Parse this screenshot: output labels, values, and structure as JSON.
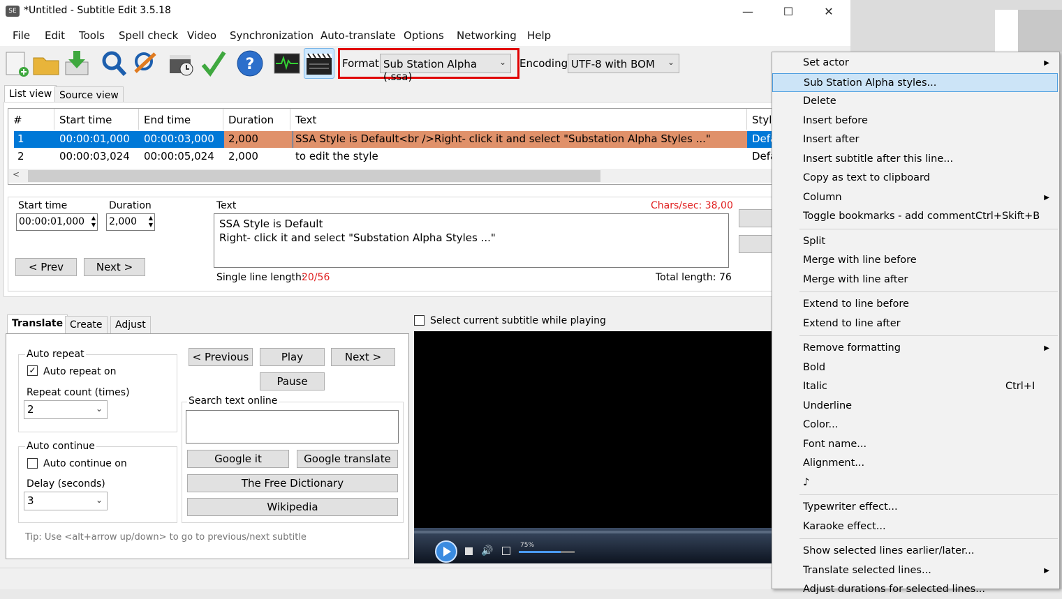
{
  "window": {
    "title": "*Untitled - Subtitle Edit 3.5.18",
    "app_icon_text": "SE",
    "minimize": "—",
    "maximize": "☐",
    "close": "✕"
  },
  "menubar": [
    "File",
    "Edit",
    "Tools",
    "Spell check",
    "Video",
    "Synchronization",
    "Auto-translate",
    "Options",
    "Networking",
    "Help"
  ],
  "toolbar": {
    "icons": [
      "new-file-icon",
      "open-folder-icon",
      "save-download-icon",
      "find-icon",
      "replace-icon",
      "visual-sync-icon",
      "spell-check-icon",
      "help-icon",
      "waveform-icon",
      "video-icon"
    ],
    "format_label": "Format",
    "format_value": "Sub Station Alpha (.ssa)",
    "encoding_label": "Encoding",
    "encoding_value": "UTF-8 with BOM"
  },
  "view_tabs": [
    "List view",
    "Source view"
  ],
  "grid": {
    "columns": [
      "#",
      "Start time",
      "End time",
      "Duration",
      "Text",
      "Style"
    ],
    "rows": [
      {
        "num": "1",
        "start": "00:00:01,000",
        "end": "00:00:03,000",
        "duration": "2,000",
        "text": "SSA Style is Default<br />Right- click it and select \"Substation Alpha Styles ...\"",
        "style": "Default"
      },
      {
        "num": "2",
        "start": "00:00:03,024",
        "end": "00:00:05,024",
        "duration": "2,000",
        "text": "to edit the style",
        "style": "Default"
      }
    ]
  },
  "editor": {
    "start_time_label": "Start time",
    "start_time_value": "00:00:01,000",
    "duration_label": "Duration",
    "duration_value": "2,000",
    "text_label": "Text",
    "chars_sec": "Chars/sec: 38,00",
    "text_line1": "SSA Style is Default",
    "text_line2": "Right- click it and select \"Substation Alpha Styles ...\"",
    "prev_button": "< Prev",
    "next_button": "Next >",
    "single_line_label": "Single line length:",
    "single_line_value": "20/56",
    "total_length": "Total length: 76"
  },
  "lower_tabs": [
    "Translate",
    "Create",
    "Adjust"
  ],
  "translate": {
    "auto_repeat_group": "Auto repeat",
    "auto_repeat_on": "Auto repeat on",
    "repeat_count_label": "Repeat count (times)",
    "repeat_count_value": "2",
    "auto_continue_group": "Auto continue",
    "auto_continue_on": "Auto continue on",
    "delay_label": "Delay (seconds)",
    "delay_value": "3",
    "previous_button": "< Previous",
    "play_button": "Play",
    "next_button": "Next >",
    "pause_button": "Pause",
    "search_group": "Search text online",
    "google_it": "Google it",
    "google_translate": "Google translate",
    "free_dictionary": "The Free Dictionary",
    "wikipedia": "Wikipedia",
    "tip": "Tip: Use <alt+arrow up/down> to go to previous/next subtitle"
  },
  "video": {
    "select_current": "Select current subtitle while playing",
    "volume": "75%"
  },
  "context_menu": [
    {
      "label": "Set actor",
      "submenu": true
    },
    {
      "label": "Sub Station Alpha styles...",
      "highlight": true
    },
    {
      "label": "Delete"
    },
    {
      "label": "Insert before"
    },
    {
      "label": "Insert after"
    },
    {
      "label": "Insert subtitle after this line..."
    },
    {
      "label": "Copy as text to clipboard"
    },
    {
      "label": "Column",
      "submenu": true
    },
    {
      "label": "Toggle bookmarks - add comment",
      "shortcut": "Ctrl+Skift+B"
    },
    {
      "separator": true
    },
    {
      "label": "Split"
    },
    {
      "label": "Merge with line before"
    },
    {
      "label": "Merge with line after"
    },
    {
      "separator": true
    },
    {
      "label": "Extend to line before"
    },
    {
      "label": "Extend to line after"
    },
    {
      "separator": true
    },
    {
      "label": "Remove formatting",
      "submenu": true
    },
    {
      "label": "Bold"
    },
    {
      "label": "Italic",
      "shortcut": "Ctrl+I"
    },
    {
      "label": "Underline"
    },
    {
      "label": "Color..."
    },
    {
      "label": "Font name..."
    },
    {
      "label": "Alignment..."
    },
    {
      "label": "♪"
    },
    {
      "separator": true
    },
    {
      "label": "Typewriter effect..."
    },
    {
      "label": "Karaoke effect..."
    },
    {
      "separator": true
    },
    {
      "label": "Show selected lines earlier/later..."
    },
    {
      "label": "Translate selected lines...",
      "submenu": true
    },
    {
      "label": "Adjust durations for selected lines..."
    }
  ],
  "colors": {
    "selection_blue": "#0078d7",
    "row_highlight_orange": "#e0916a",
    "format_outline_red": "#e00000",
    "menu_highlight": "#cce4f7",
    "chars_sec_red": "#e02020"
  }
}
